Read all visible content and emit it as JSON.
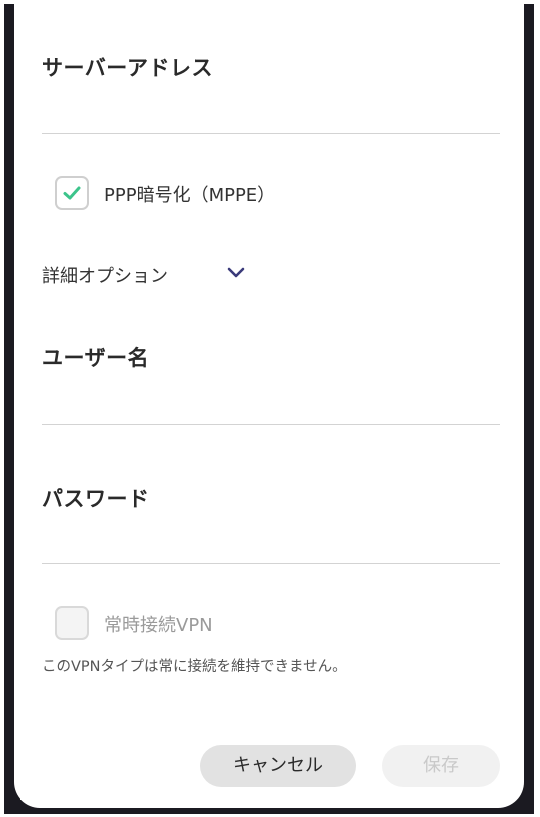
{
  "dialog": {
    "server_address_label": "サーバーアドレス",
    "ppp_encryption": {
      "label": "PPP暗号化（MPPE）",
      "checked": true
    },
    "advanced_options": {
      "label": "詳細オプション",
      "icon": "chevron-down-icon"
    },
    "username_label": "ユーザー名",
    "password_label": "パスワード",
    "always_on_vpn": {
      "label": "常時接続VPN",
      "checked": false,
      "disabled": true
    },
    "note": "このVPNタイプは常に接続を維持できません。",
    "buttons": {
      "cancel": "キャンセル",
      "save": "保存"
    }
  },
  "colors": {
    "accent": "#3cc48b",
    "chevron": "#3a3a7a",
    "divider": "#d3d3d3",
    "device_frame": "#1b1a21"
  }
}
